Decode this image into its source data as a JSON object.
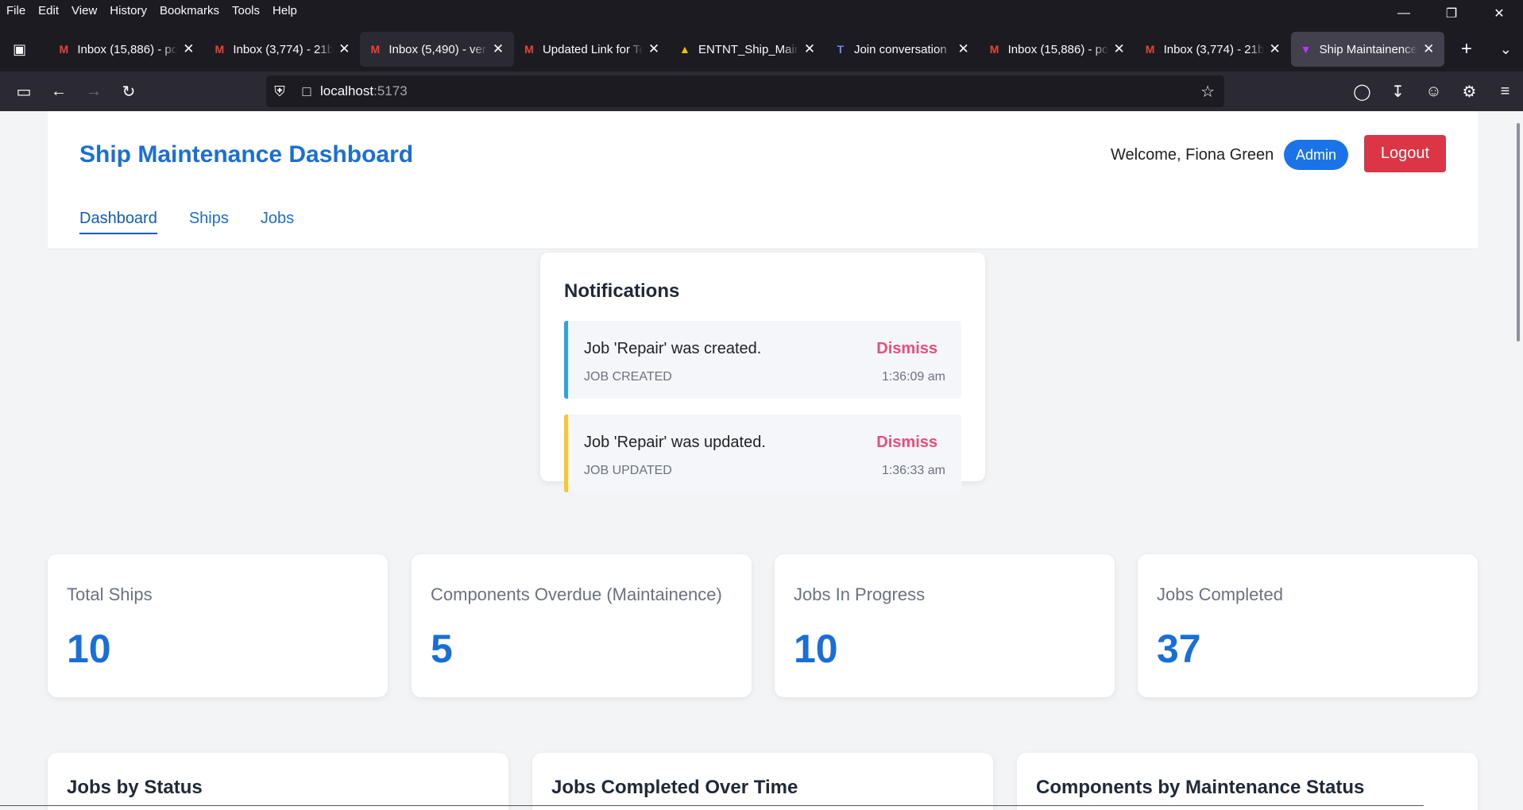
{
  "browser": {
    "menu": [
      "File",
      "Edit",
      "View",
      "History",
      "Bookmarks",
      "Tools",
      "Help"
    ],
    "tabs": [
      {
        "icon": "gmail-icon",
        "label": "Inbox (15,886) - po"
      },
      {
        "icon": "gmail-icon",
        "label": "Inbox (3,774) - 21b"
      },
      {
        "icon": "gmail-icon",
        "label": "Inbox (5,490) - ver"
      },
      {
        "icon": "gmail-icon",
        "label": "Updated Link for Te"
      },
      {
        "icon": "google-drive-icon",
        "label": "ENTNT_Ship_Maint"
      },
      {
        "icon": "teams-icon",
        "label": "Join conversation"
      },
      {
        "icon": "gmail-icon",
        "label": "Inbox (15,886) - po"
      },
      {
        "icon": "gmail-icon",
        "label": "Inbox (3,774) - 21b"
      },
      {
        "icon": "vite-icon",
        "label": "Ship Maintainence"
      }
    ],
    "url_host": "localhost",
    "url_port": ":5173"
  },
  "header": {
    "title": "Ship Maintenance Dashboard",
    "welcome": "Welcome, Fiona Green",
    "role": "Admin",
    "logout": "Logout",
    "nav": [
      "Dashboard",
      "Ships",
      "Jobs"
    ]
  },
  "notifications": {
    "title": "Notifications",
    "items": [
      {
        "message": "Job 'Repair' was created.",
        "type": "JOB CREATED",
        "time": "1:36:09 am",
        "dismiss": "Dismiss",
        "color": "#3aa0d8"
      },
      {
        "message": "Job 'Repair' was updated.",
        "type": "JOB UPDATED",
        "time": "1:36:33 am",
        "dismiss": "Dismiss",
        "color": "#f5c542"
      }
    ]
  },
  "stats": [
    {
      "label": "Total Ships",
      "value": "10"
    },
    {
      "label": "Components Overdue (Maintainence)",
      "value": "5"
    },
    {
      "label": "Jobs In Progress",
      "value": "10"
    },
    {
      "label": "Jobs Completed",
      "value": "37"
    }
  ],
  "charts": [
    {
      "title": "Jobs by Status"
    },
    {
      "title": "Jobs Completed Over Time"
    },
    {
      "title": "Components by Maintenance Status"
    }
  ],
  "colors": {
    "primary": "#1a6fd6",
    "danger": "#dc3545",
    "dismiss": "#e94e77"
  }
}
